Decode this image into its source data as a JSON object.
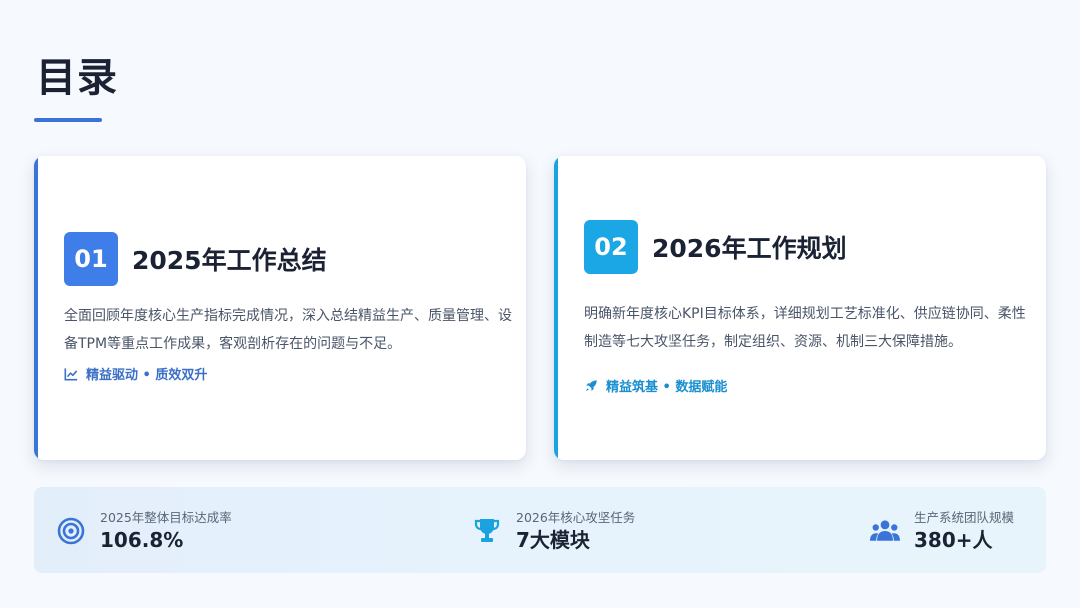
{
  "page": {
    "title": "目录"
  },
  "sections": [
    {
      "number": "01",
      "title": "2025年工作总结",
      "description": "全面回顾年度核心生产指标完成情况，深入总结精益生产、质量管理、设备TPM等重点工作成果，客观剖析存在的问题与不足。",
      "tag": "精益驱动 • 质效双升",
      "tag_icon": "chart-line-icon",
      "accent_color": "#3b74d8"
    },
    {
      "number": "02",
      "title": "2026年工作规划",
      "description": "明确新年度核心KPI目标体系，详细规划工艺标准化、供应链协同、柔性制造等七大攻坚任务，制定组织、资源、机制三大保障措施。",
      "tag": "精益筑基 • 数据赋能",
      "tag_icon": "rocket-icon",
      "accent_color": "#1aa3e0"
    }
  ],
  "stats": [
    {
      "label": "2025年整体目标达成率",
      "value": "106.8%",
      "icon": "target-icon",
      "color": "#3b74d8"
    },
    {
      "label": "2026年核心攻坚任务",
      "value": "7大模块",
      "icon": "trophy-icon",
      "color": "#1aa3e0"
    },
    {
      "label": "生产系统团队规模",
      "value": "380+人",
      "icon": "users-icon",
      "color": "#3b74d8"
    }
  ]
}
